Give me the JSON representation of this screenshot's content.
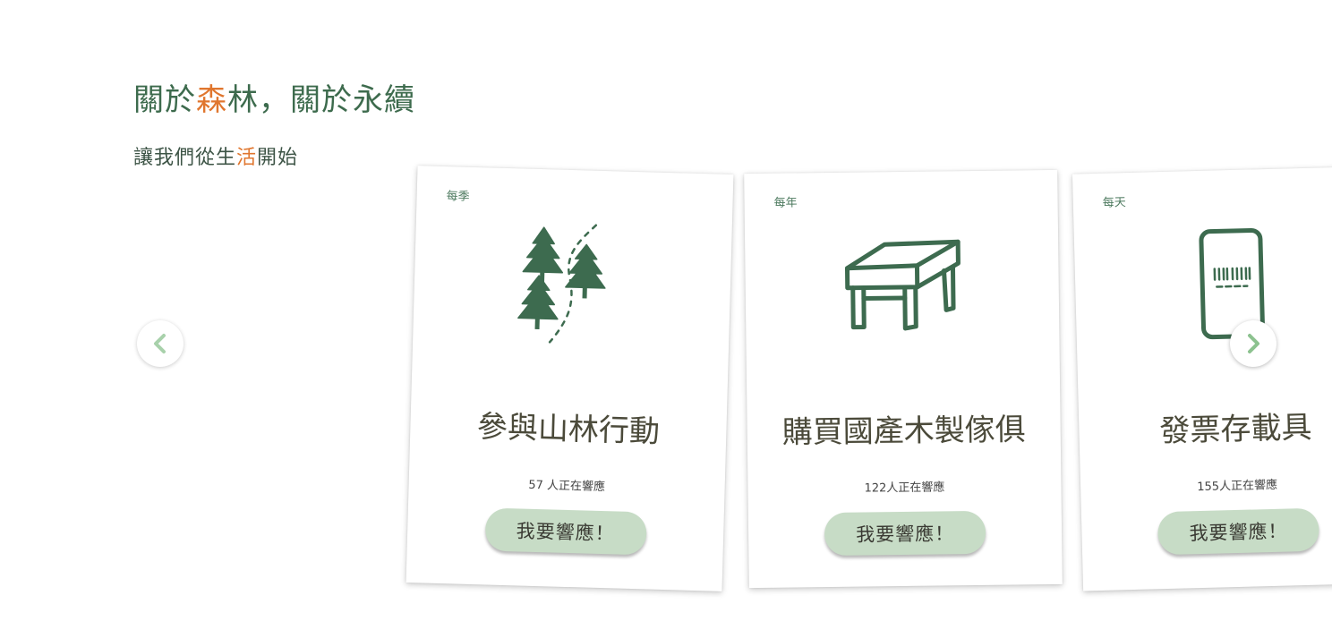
{
  "header": {
    "title_part1": "關於",
    "title_accent": "森",
    "title_part2": "林，關於永續",
    "subtitle_part1": "讓我們從生",
    "subtitle_accent": "活",
    "subtitle_part2": "開始"
  },
  "cards": [
    {
      "frequency": "每季",
      "title": "參與山林行動",
      "count_text": "57  人正在響應",
      "button_label": "我要響應！",
      "icon": "trees-path-icon"
    },
    {
      "frequency": "每年",
      "title": "購買國產木製傢俱",
      "count_text": "122人正在響應",
      "button_label": "我要響應！",
      "icon": "table-icon"
    },
    {
      "frequency": "每天",
      "title": "發票存載具",
      "count_text": "155人正在響應",
      "button_label": "我要響應！",
      "icon": "phone-barcode-icon"
    }
  ],
  "navigation": {
    "prev_icon": "chevron-left-icon",
    "next_icon": "chevron-right-icon"
  },
  "colors": {
    "title_green": "#3d6b4d",
    "accent_orange": "#e0762e",
    "button_green": "#c7dcc6",
    "icon_green": "#3d6b4f",
    "arrow_green": "#8cc28f"
  }
}
